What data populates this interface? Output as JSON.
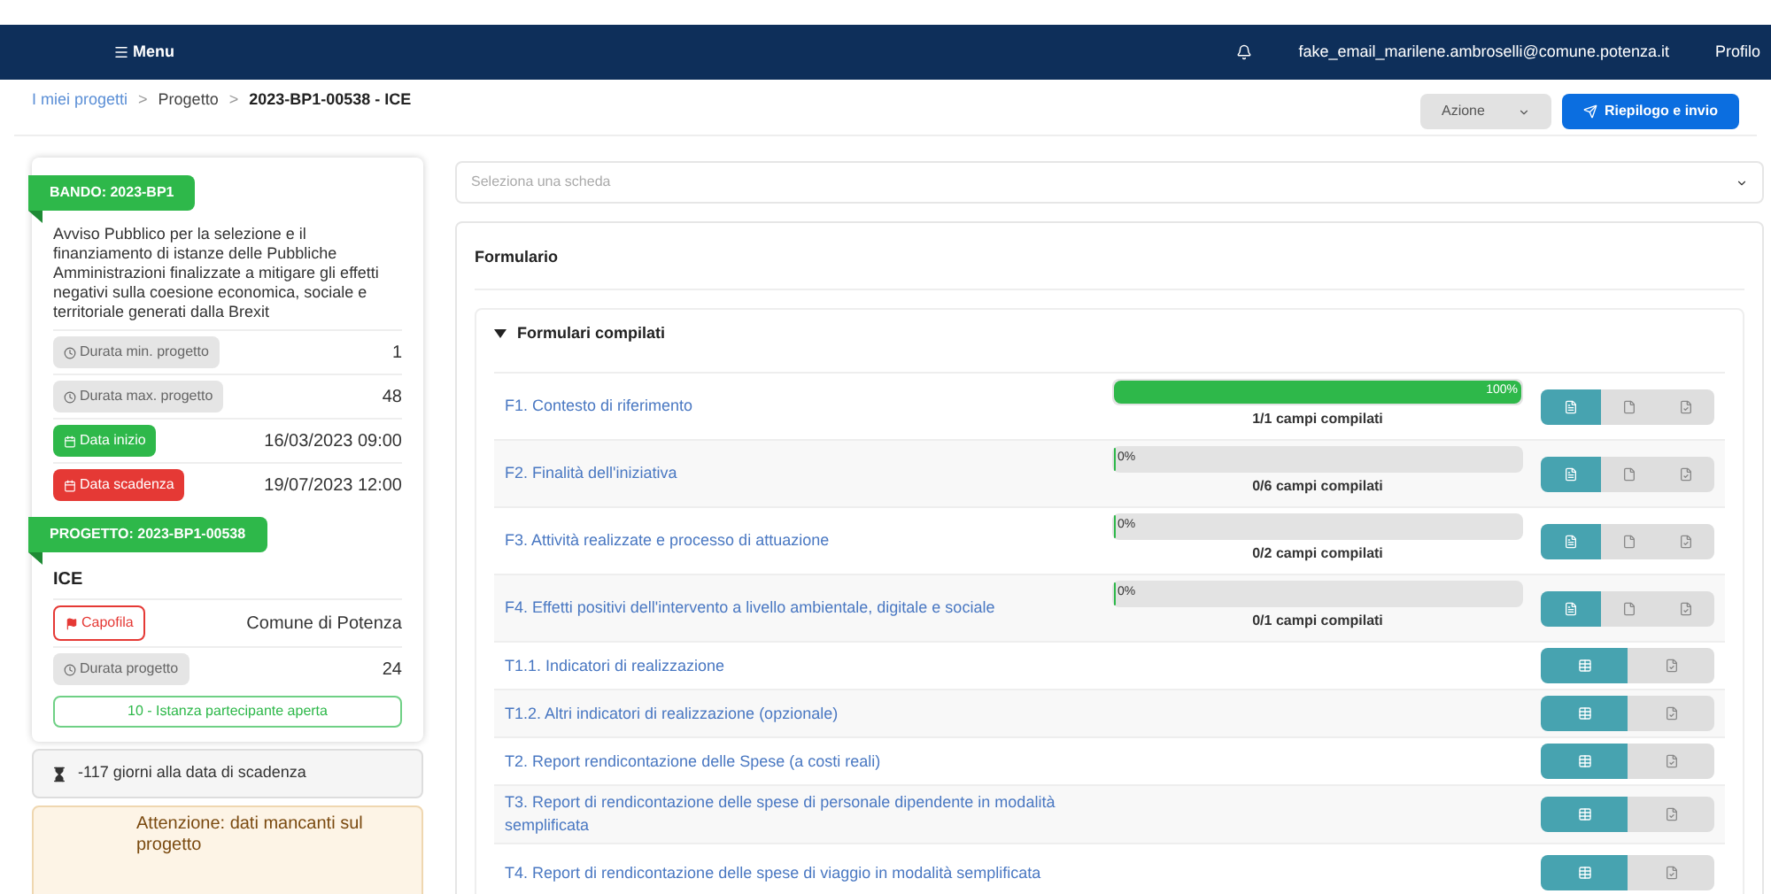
{
  "navbar": {
    "menu": "Menu",
    "email": "fake_email_marilene.ambroselli@comune.potenza.it",
    "profile": "Profilo"
  },
  "breadcrumb": {
    "separator": ">",
    "items": [
      "I miei progetti",
      "Progetto",
      "2023-BP1-00538 - ICE"
    ]
  },
  "actions": {
    "dropdown": "Azione",
    "submit": "Riepilogo e invio"
  },
  "bando": {
    "ribbon": "BANDO: 2023-BP1",
    "description": "Avviso Pubblico per la selezione e il finanziamento di istanze delle Pubbliche Amministrazioni finalizzate a mitigare gli effetti negativi sulla coesione economica, sociale e territoriale generati dalla Brexit",
    "rows": [
      {
        "kind": "duration",
        "label": "Durata min. progetto",
        "value": "1"
      },
      {
        "kind": "duration",
        "label": "Durata max. progetto",
        "value": "48"
      },
      {
        "kind": "start",
        "label": "Data inizio",
        "value": "16/03/2023 09:00"
      },
      {
        "kind": "deadline",
        "label": "Data scadenza",
        "value": "19/07/2023 12:00"
      }
    ]
  },
  "progetto": {
    "ribbon": "PROGETTO: 2023-BP1-00538",
    "name": "ICE",
    "rows": [
      {
        "kind": "lead",
        "label": "Capofila",
        "value": "Comune di Potenza"
      },
      {
        "kind": "duration",
        "label": "Durata progetto",
        "value": "24"
      }
    ],
    "status": "10 - Istanza partecipante aperta"
  },
  "countdown": "-117 giorni alla data di scadenza",
  "warning": "Attenzione: dati mancanti sul progetto",
  "select_placeholder": "Seleziona una scheda",
  "panel_title": "Formulario",
  "section": {
    "title": "Formulari compilati",
    "expanded": true,
    "rows": [
      {
        "kind": "form",
        "label": "F1. Contesto di riferimento",
        "level": 1,
        "percent": "100%",
        "fields": "1/1 campi compilati"
      },
      {
        "kind": "form",
        "label": "F2. Finalità dell'iniziativa",
        "level": 0,
        "percent": "0%",
        "fields": "0/6 campi compilati"
      },
      {
        "kind": "form",
        "label": "F3. Attività realizzate e processo di attuazione",
        "level": 0,
        "percent": "0%",
        "fields": "0/2 campi compilati"
      },
      {
        "kind": "form",
        "label": "F4. Effetti positivi dell'intervento a livello ambientale, digitale e sociale",
        "level": 0,
        "percent": "0%",
        "fields": "0/1 campi compilati"
      },
      {
        "kind": "table",
        "label": "T1.1. Indicatori di realizzazione"
      },
      {
        "kind": "table",
        "label": "T1.2. Altri indicatori di realizzazione (opzionale)"
      },
      {
        "kind": "table",
        "label": "T2. Report rendicontazione delle Spese (a costi reali)"
      },
      {
        "kind": "table",
        "label": "T3. Report di rendicontazione delle spese di personale dipendente in modalità semplificata"
      },
      {
        "kind": "table",
        "label": "T4. Report di rendicontazione delle spese di viaggio in modalità semplificata"
      }
    ]
  }
}
